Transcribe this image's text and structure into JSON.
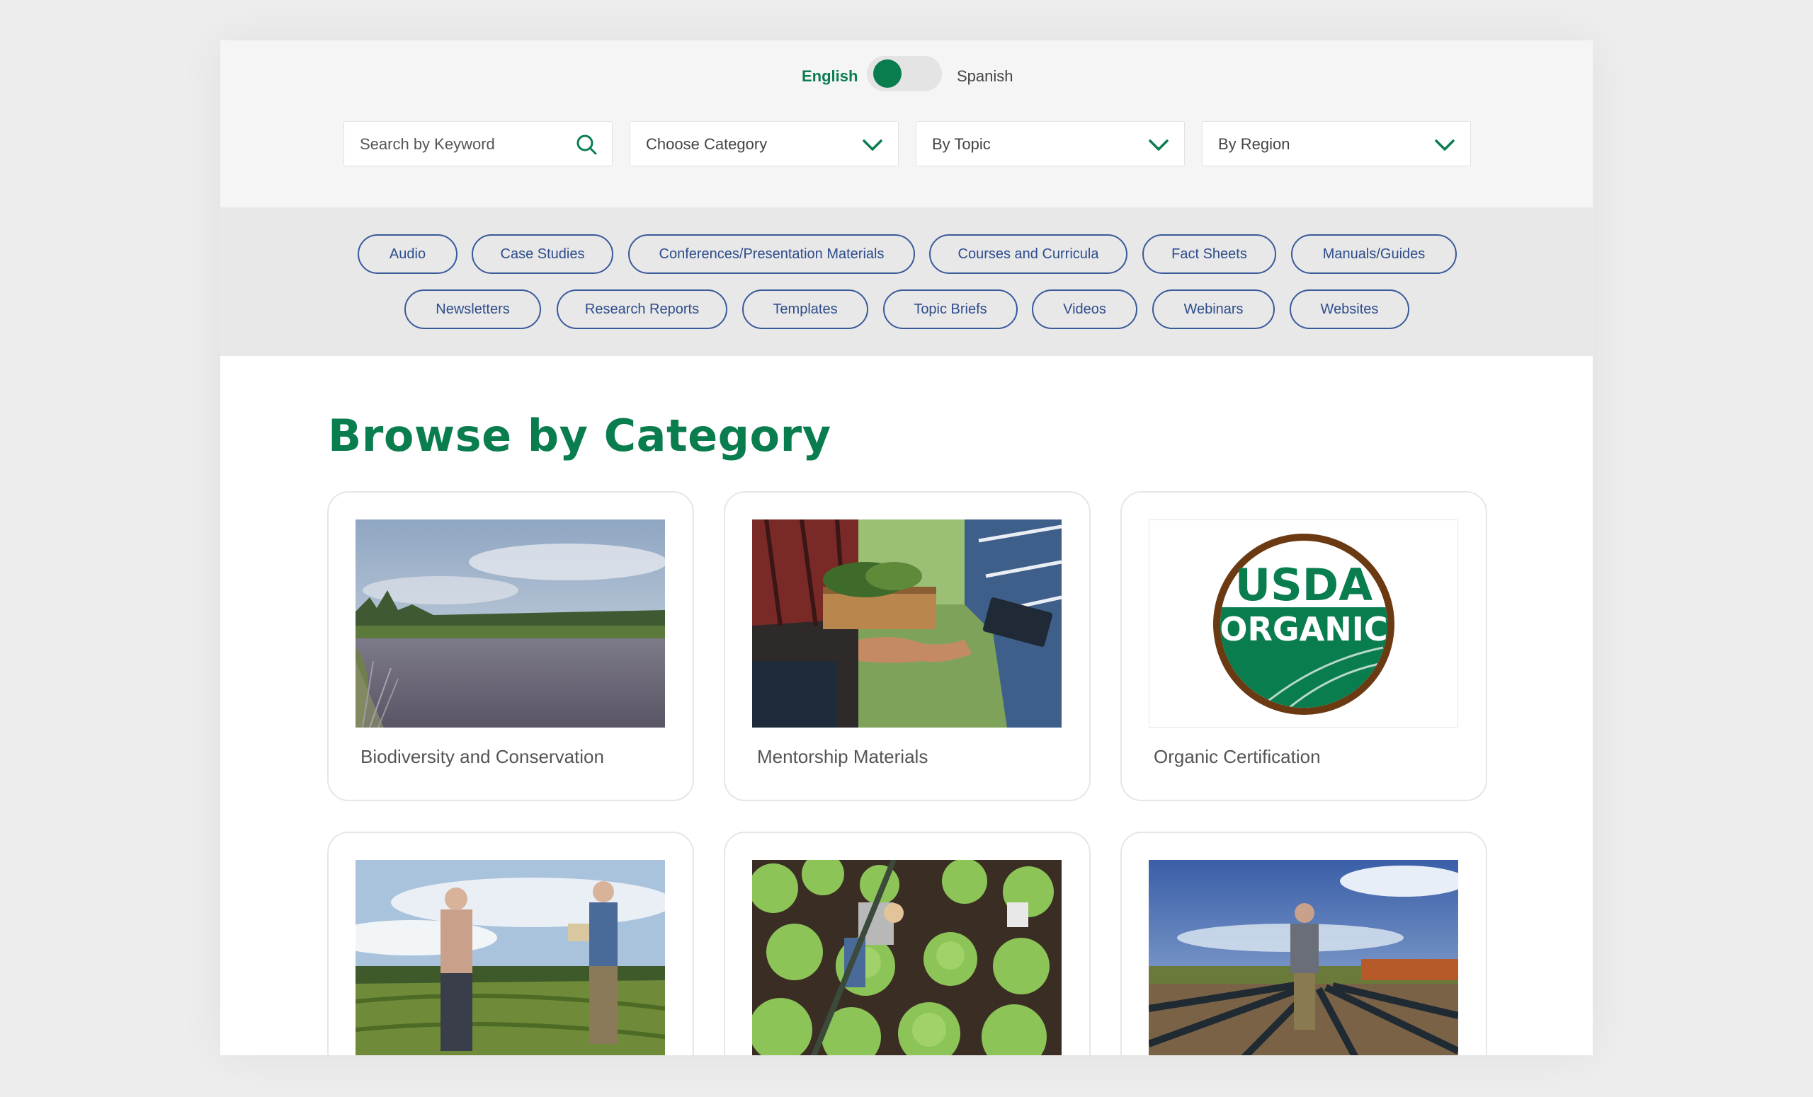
{
  "language": {
    "left": "English",
    "right": "Spanish",
    "active": "English"
  },
  "filters": {
    "search_placeholder": "Search by Keyword",
    "category": "Choose Category",
    "topic": "By Topic",
    "region": "By Region"
  },
  "chips": {
    "row1": [
      "Audio",
      "Case Studies",
      "Conferences/Presentation Materials",
      "Courses and Curricula",
      "Fact Sheets",
      "Manuals/Guides"
    ],
    "row2": [
      "Newsletters",
      "Research Reports",
      "Templates",
      "Topic Briefs",
      "Videos",
      "Webinars",
      "Websites"
    ]
  },
  "section_title": "Browse by Category",
  "cards": [
    {
      "label": "Biodiversity and Conservation"
    },
    {
      "label": "Mentorship Materials"
    },
    {
      "label": "Organic Certification"
    },
    {
      "label": ""
    },
    {
      "label": ""
    },
    {
      "label": ""
    }
  ],
  "usda_logo": {
    "top": "USDA",
    "bottom": "ORGANIC"
  },
  "colors": {
    "brand_green": "#0a7d4f",
    "chip_blue": "#2e4d8c",
    "usda_brown": "#6b3a12"
  }
}
